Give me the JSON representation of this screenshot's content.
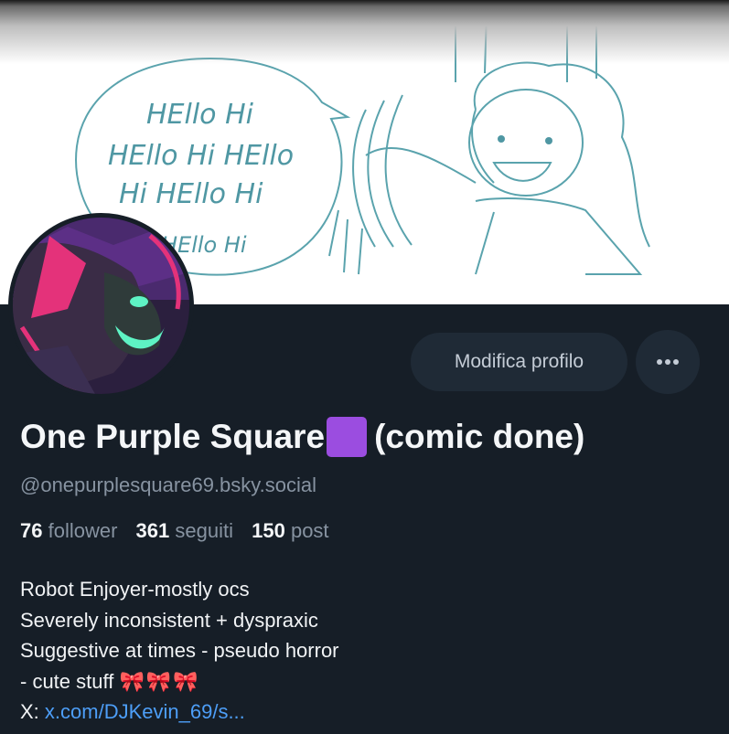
{
  "banner": {
    "speech_lines": [
      "HEllo Hi",
      "HEllo Hi HEllo",
      "Hi HEllo Hi",
      "HEllo Hi"
    ]
  },
  "profile": {
    "display_name_before": "One Purple Square",
    "display_name_after": "(comic done)",
    "handle": "@onepurplesquare69.bsky.social"
  },
  "actions": {
    "edit_label": "Modifica profilo",
    "more_label": "•••"
  },
  "stats": {
    "followers_count": "76",
    "followers_label": "follower",
    "following_count": "361",
    "following_label": "seguiti",
    "posts_count": "150",
    "posts_label": "post"
  },
  "bio": {
    "line1": "Robot Enjoyer-mostly ocs",
    "line2": "Severely inconsistent + dyspraxic",
    "line3": "Suggestive at times - pseudo horror",
    "line4": "- cute stuff",
    "bows": "🎀🎀🎀",
    "link_prefix": "X:",
    "link_text": "x.com/DJKevin_69/s..."
  },
  "colors": {
    "background": "#161e27",
    "button": "#1f2a36",
    "accent_link": "#4d9ef7",
    "purple_square": "#9b4de0",
    "muted_text": "#8793a1"
  }
}
